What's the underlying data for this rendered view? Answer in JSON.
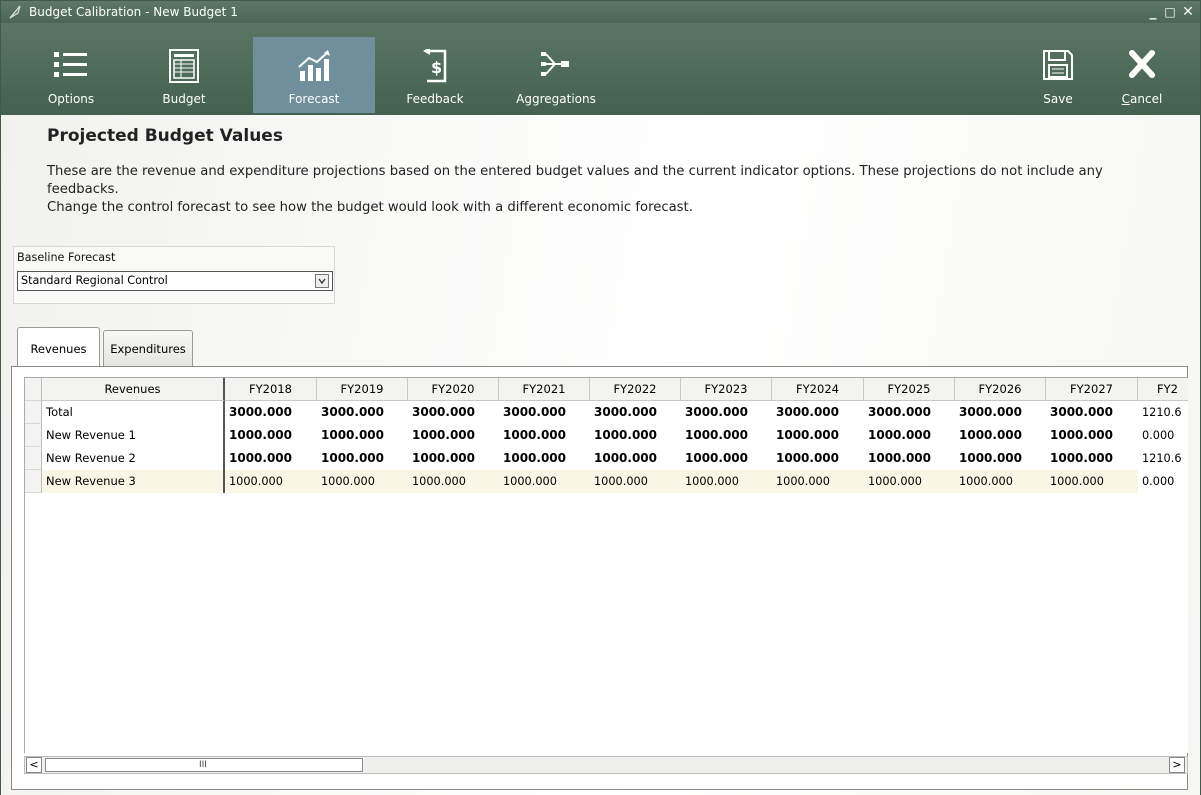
{
  "window": {
    "title": "Budget Calibration - New Budget 1",
    "controls": {
      "minimize": "_",
      "maximize": "□",
      "close": "✕"
    }
  },
  "ribbon": {
    "buttons": [
      {
        "label": "Options",
        "icon": "list-icon"
      },
      {
        "label": "Budget",
        "icon": "budget-sheet-icon"
      },
      {
        "label": "Forecast",
        "icon": "chart-growth-icon",
        "active": true
      },
      {
        "label": "Feedback",
        "icon": "dollar-feedback-icon"
      },
      {
        "label": "Aggregations",
        "icon": "aggregation-icon"
      },
      {
        "label": "Save",
        "icon": "floppy-disk-icon"
      },
      {
        "label": "Cancel",
        "icon": "close-x-icon",
        "mnemonic": "C"
      }
    ]
  },
  "content": {
    "heading": "Projected Budget Values",
    "paragraph_line1": "These are the revenue and expenditure projections based on the entered budget values and the current indicator options. These projections do not include any",
    "paragraph_line2": "feedbacks.",
    "paragraph_line3": "Change the control forecast to see how the budget would look with a different economic forecast.",
    "baseline_forecast_label": "Baseline Forecast",
    "baseline_forecast_value": "Standard Regional Control"
  },
  "tabs": [
    {
      "label": "Revenues",
      "active": true
    },
    {
      "label": "Expenditures",
      "active": false
    }
  ],
  "grid": {
    "columns": [
      "Revenues",
      "FY2018",
      "FY2019",
      "FY2020",
      "FY2021",
      "FY2022",
      "FY2023",
      "FY2024",
      "FY2025",
      "FY2026",
      "FY2027",
      "FY2"
    ],
    "rows": [
      {
        "name": "Total",
        "values": [
          "3000.000",
          "3000.000",
          "3000.000",
          "3000.000",
          "3000.000",
          "3000.000",
          "3000.000",
          "3000.000",
          "3000.000",
          "3000.000"
        ],
        "last": "1210.6",
        "bold": true
      },
      {
        "name": "New Revenue 1",
        "values": [
          "1000.000",
          "1000.000",
          "1000.000",
          "1000.000",
          "1000.000",
          "1000.000",
          "1000.000",
          "1000.000",
          "1000.000",
          "1000.000"
        ],
        "last": "0.000",
        "bold": true
      },
      {
        "name": "New Revenue 2",
        "values": [
          "1000.000",
          "1000.000",
          "1000.000",
          "1000.000",
          "1000.000",
          "1000.000",
          "1000.000",
          "1000.000",
          "1000.000",
          "1000.000"
        ],
        "last": "1210.6",
        "bold": true
      },
      {
        "name": "New Revenue 3",
        "values": [
          "1000.000",
          "1000.000",
          "1000.000",
          "1000.000",
          "1000.000",
          "1000.000",
          "1000.000",
          "1000.000",
          "1000.000",
          "1000.000"
        ],
        "last": "0.000",
        "bold": false
      }
    ]
  },
  "scrollbar": {
    "left_arrow": "<",
    "right_arrow": ">",
    "grip": "III"
  }
}
